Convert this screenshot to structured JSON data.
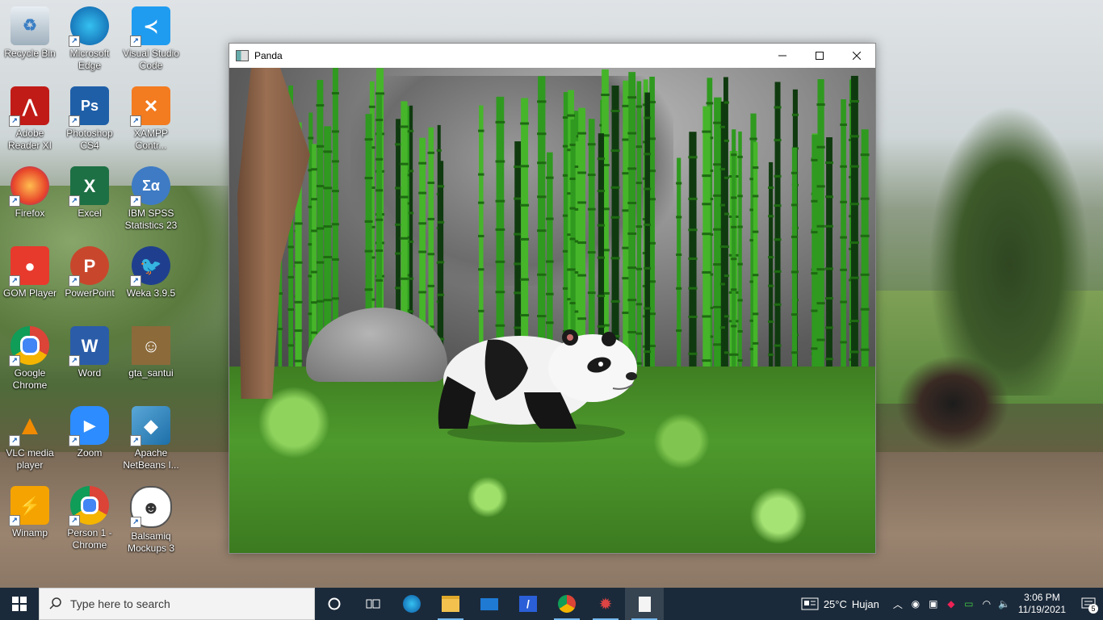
{
  "desktop": {
    "icons": [
      {
        "label": "Recycle Bin",
        "icon": "recycle-bin-icon"
      },
      {
        "label": "Microsoft Edge",
        "icon": "edge-icon"
      },
      {
        "label": "Visual Studio Code",
        "icon": "vscode-icon"
      },
      {
        "label": "Adobe Reader XI",
        "icon": "adobe-reader-icon"
      },
      {
        "label": "Photoshop CS4",
        "icon": "photoshop-icon"
      },
      {
        "label": "XAMPP Contr...",
        "icon": "xampp-icon"
      },
      {
        "label": "Firefox",
        "icon": "firefox-icon"
      },
      {
        "label": "Excel",
        "icon": "excel-icon"
      },
      {
        "label": "IBM SPSS Statistics 23",
        "icon": "spss-icon"
      },
      {
        "label": "GOM Player",
        "icon": "gom-player-icon"
      },
      {
        "label": "PowerPoint",
        "icon": "powerpoint-icon"
      },
      {
        "label": "Weka 3.9.5",
        "icon": "weka-icon"
      },
      {
        "label": "Google Chrome",
        "icon": "chrome-icon"
      },
      {
        "label": "Word",
        "icon": "word-icon"
      },
      {
        "label": "gta_santui",
        "icon": "gta-icon"
      },
      {
        "label": "VLC media player",
        "icon": "vlc-icon"
      },
      {
        "label": "Zoom",
        "icon": "zoom-icon"
      },
      {
        "label": "Apache NetBeans I...",
        "icon": "netbeans-icon"
      },
      {
        "label": "Winamp",
        "icon": "winamp-icon"
      },
      {
        "label": "Person 1 - Chrome",
        "icon": "chrome-profile-icon"
      },
      {
        "label": "Balsamiq Mockups 3",
        "icon": "balsamiq-icon"
      }
    ]
  },
  "window": {
    "title": "Panda",
    "controls": {
      "minimize": "minimize-icon",
      "maximize": "maximize-icon",
      "close": "close-icon"
    }
  },
  "taskbar": {
    "search_placeholder": "Type here to search",
    "apps": [
      "cortana-icon",
      "task-view-icon",
      "edge-icon",
      "file-explorer-icon",
      "mail-icon",
      "app-icon",
      "chrome-icon",
      "spider-app-icon",
      "panda-window-icon"
    ],
    "weather": {
      "temp": "25°C",
      "condition": "Hujan"
    },
    "clock": {
      "time": "3:06 PM",
      "date": "11/19/2021"
    },
    "notifications_count": "5"
  }
}
